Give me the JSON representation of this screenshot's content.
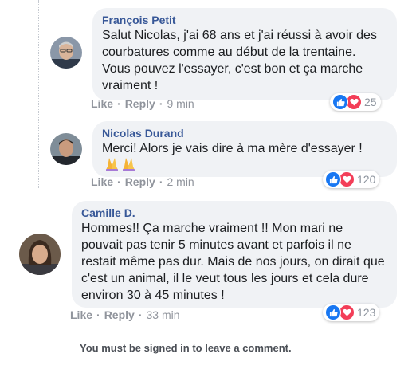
{
  "comments": [
    {
      "author": "François Petit",
      "text": "Salut Nicolas, j'ai 68 ans et j'ai réussi à avoir des courbatures comme au début de la trentaine. Vous pouvez l'essayer, c'est bon et ça marche vraiment !",
      "like_label": "Like",
      "reply_label": "Reply",
      "separator": "·",
      "time": "9 min",
      "reaction_count": "25"
    },
    {
      "author": "Nicolas Durand",
      "text": "Merci! Alors je vais dire à ma mère d'essayer !",
      "like_label": "Like",
      "reply_label": "Reply",
      "separator": "·",
      "time": "2 min",
      "reaction_count": "120"
    },
    {
      "author": "Camille D.",
      "text": "Hommes!! Ça marche vraiment !! Mon mari ne pouvait pas tenir 5 minutes avant et parfois il ne restait même pas dur. Mais de nos jours, on dirait que c'est un animal, il le veut tous les jours et cela dure environ 30 à 45 minutes !",
      "like_label": "Like",
      "reply_label": "Reply",
      "separator": "·",
      "time": "33 min",
      "reaction_count": "123"
    }
  ],
  "footer": {
    "signin_notice": "You must be signed in to leave a comment."
  },
  "icons": {
    "like": "thumbs-up-icon",
    "love": "heart-icon",
    "pray": "folded-hands-emoji"
  },
  "colors": {
    "author": "#385898",
    "bubble": "#f0f2f5",
    "like_blue": "#1877f2",
    "love_red": "#f33e58",
    "meta_gray": "#90949c"
  }
}
